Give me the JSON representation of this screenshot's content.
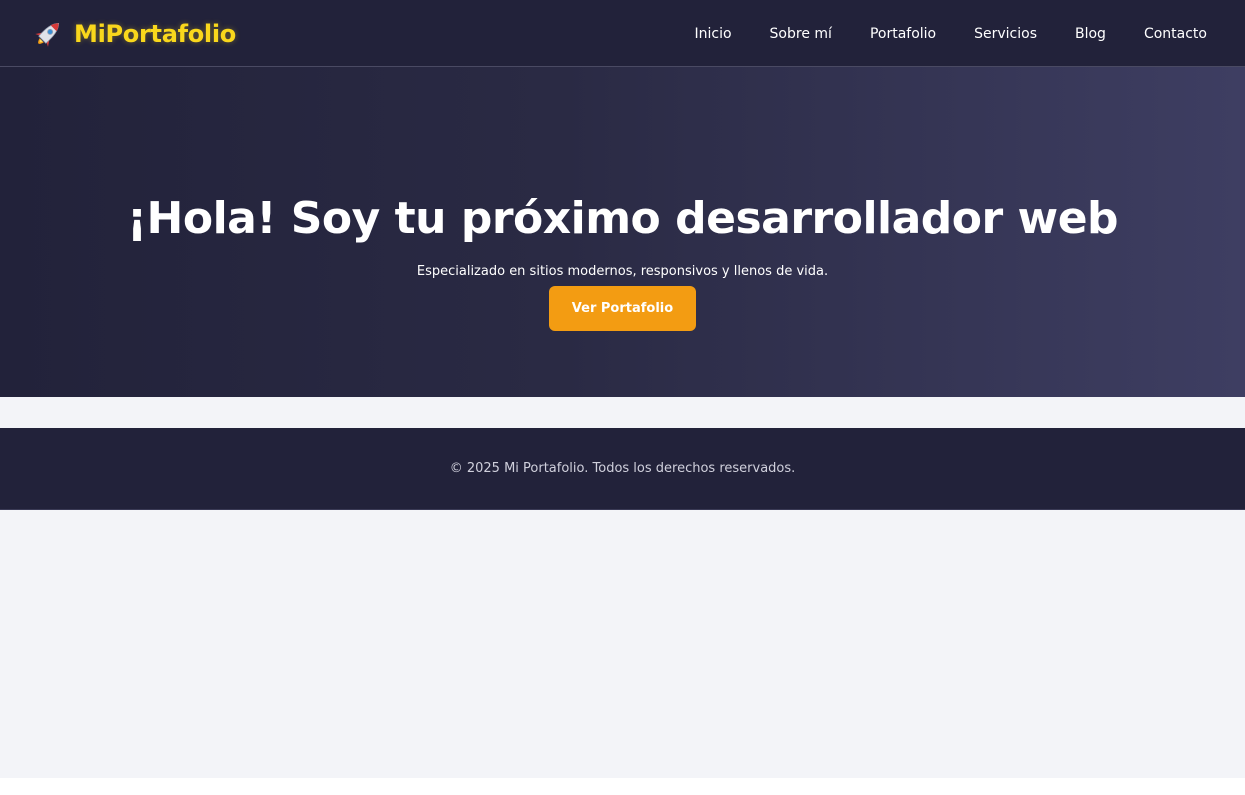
{
  "header": {
    "brand_icon": "rocket-icon",
    "brand_name": "MiPortafolio",
    "brand_color": "#f9d71c",
    "background_color": "#22223a",
    "nav": [
      {
        "label": "Inicio"
      },
      {
        "label": "Sobre mí"
      },
      {
        "label": "Portafolio"
      },
      {
        "label": "Servicios"
      },
      {
        "label": "Blog"
      },
      {
        "label": "Contacto"
      }
    ]
  },
  "hero": {
    "title": "¡Hola! Soy tu próximo desarrollador web",
    "subtitle": "Especializado en sitios modernos, responsivos y llenos de vida.",
    "button_label": "Ver Portafolio",
    "button_color": "#f39c12"
  },
  "footer": {
    "text": "© 2025 Mi Portafolio. Todos los derechos reservados."
  },
  "colors": {
    "page_background": "#f3f4f8",
    "dark": "#22223a"
  }
}
